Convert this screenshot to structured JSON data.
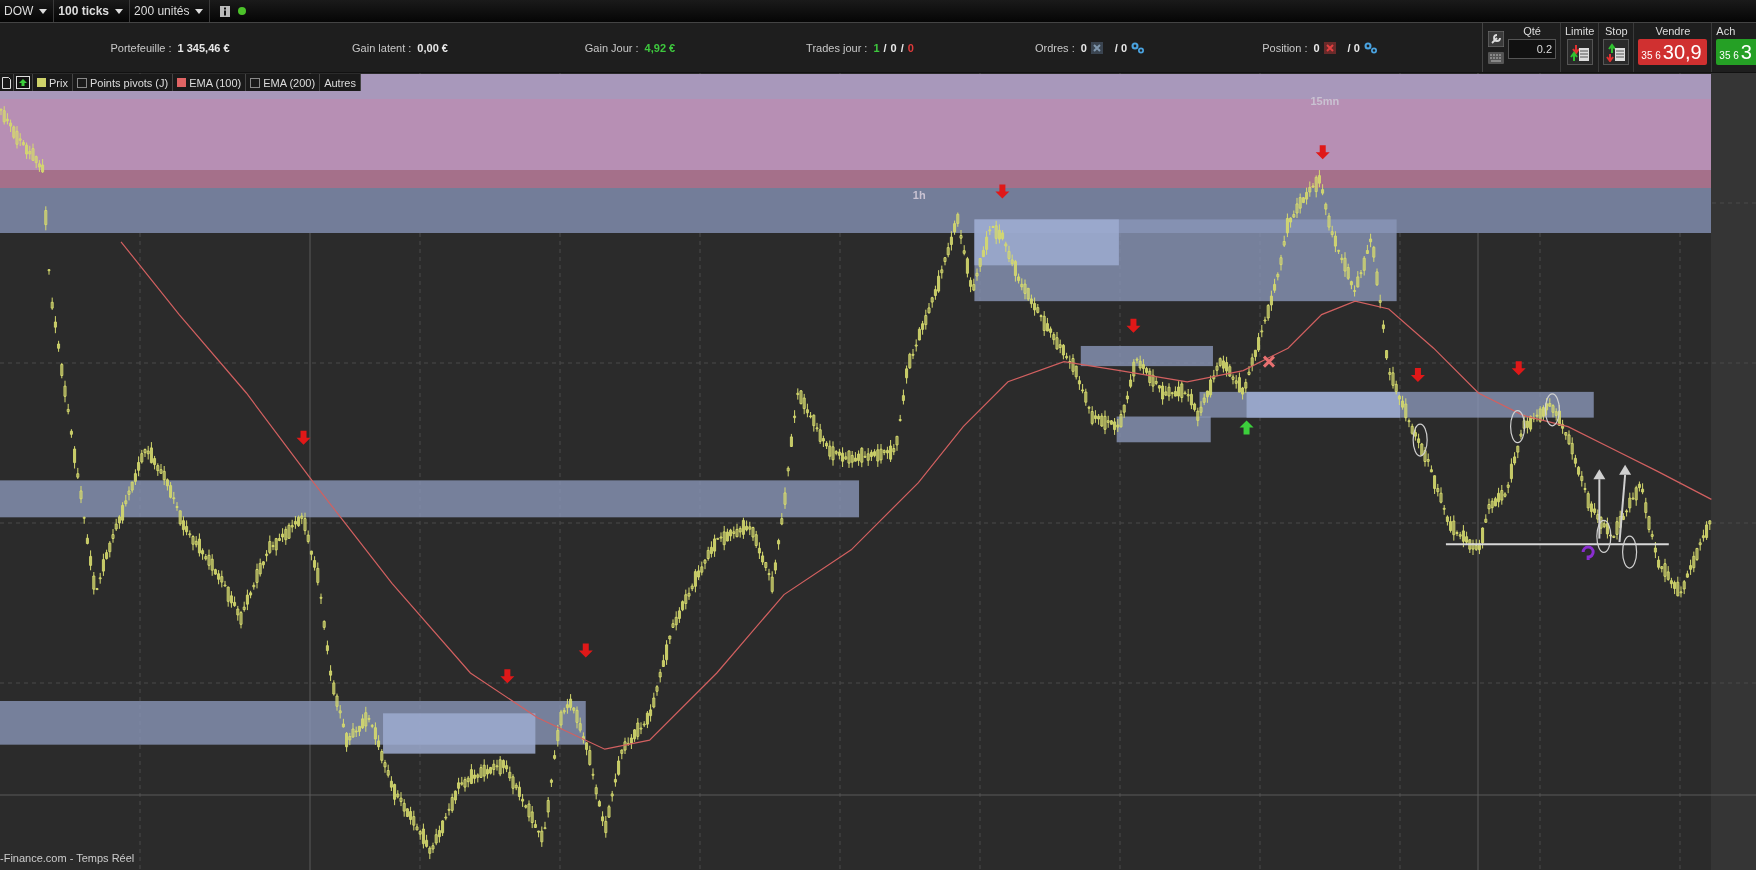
{
  "toolbar": {
    "selectors": [
      {
        "label": "DOW"
      },
      {
        "label": "100 ticks"
      },
      {
        "label": "200 unités"
      }
    ],
    "connected": true
  },
  "stats": [
    {
      "kind": "value",
      "label": "Portefeuille :",
      "parts": [
        {
          "text": "1 345,46 €",
          "color": "#e8e8e8"
        }
      ]
    },
    {
      "kind": "value",
      "label": "Gain latent :",
      "parts": [
        {
          "text": "0,00 €",
          "color": "#e8e8e8"
        }
      ]
    },
    {
      "kind": "value",
      "label": "Gain Jour :",
      "parts": [
        {
          "text": "4,92 €",
          "color": "#3ec83e"
        }
      ]
    },
    {
      "kind": "value",
      "label": "Trades jour :",
      "parts": [
        {
          "text": "1",
          "color": "#3ec83e"
        },
        {
          "text": "/",
          "color": "#e8e8e8"
        },
        {
          "text": "0",
          "color": "#e8e8e8"
        },
        {
          "text": "/",
          "color": "#e8e8e8"
        },
        {
          "text": "0",
          "color": "#e03a3a"
        }
      ]
    },
    {
      "kind": "orders",
      "label": "Ordres :",
      "count": "0",
      "pending": "/ 0",
      "alert": false
    },
    {
      "kind": "orders",
      "label": "Position :",
      "count": "0",
      "pending": "/ 0",
      "alert": true
    }
  ],
  "trade_panel": {
    "qty_label": "Qté",
    "qty_value": "0.2",
    "limit_label": "Limite",
    "stop_label": "Stop",
    "sell": {
      "label": "Vendre",
      "prefix": "35 6",
      "price": "30,9"
    },
    "buy": {
      "label": "Ach",
      "prefix": "35 6",
      "price": "3"
    }
  },
  "legend": [
    {
      "kind": "icon"
    },
    {
      "kind": "icon"
    },
    {
      "kind": "swatch",
      "label": "Prix",
      "color": "#cfd36a"
    },
    {
      "kind": "checkbox",
      "label": "Points pivots (J)",
      "checked": false
    },
    {
      "kind": "swatch",
      "label": "EMA (100)",
      "color": "#e06464"
    },
    {
      "kind": "checkbox",
      "label": "EMA (200)",
      "checked": false
    },
    {
      "kind": "plain",
      "label": "Autres"
    }
  ],
  "chart_labels": [
    {
      "text": "1h"
    },
    {
      "text": "15mn"
    }
  ],
  "source": "-Finance.com - Temps Réel"
}
